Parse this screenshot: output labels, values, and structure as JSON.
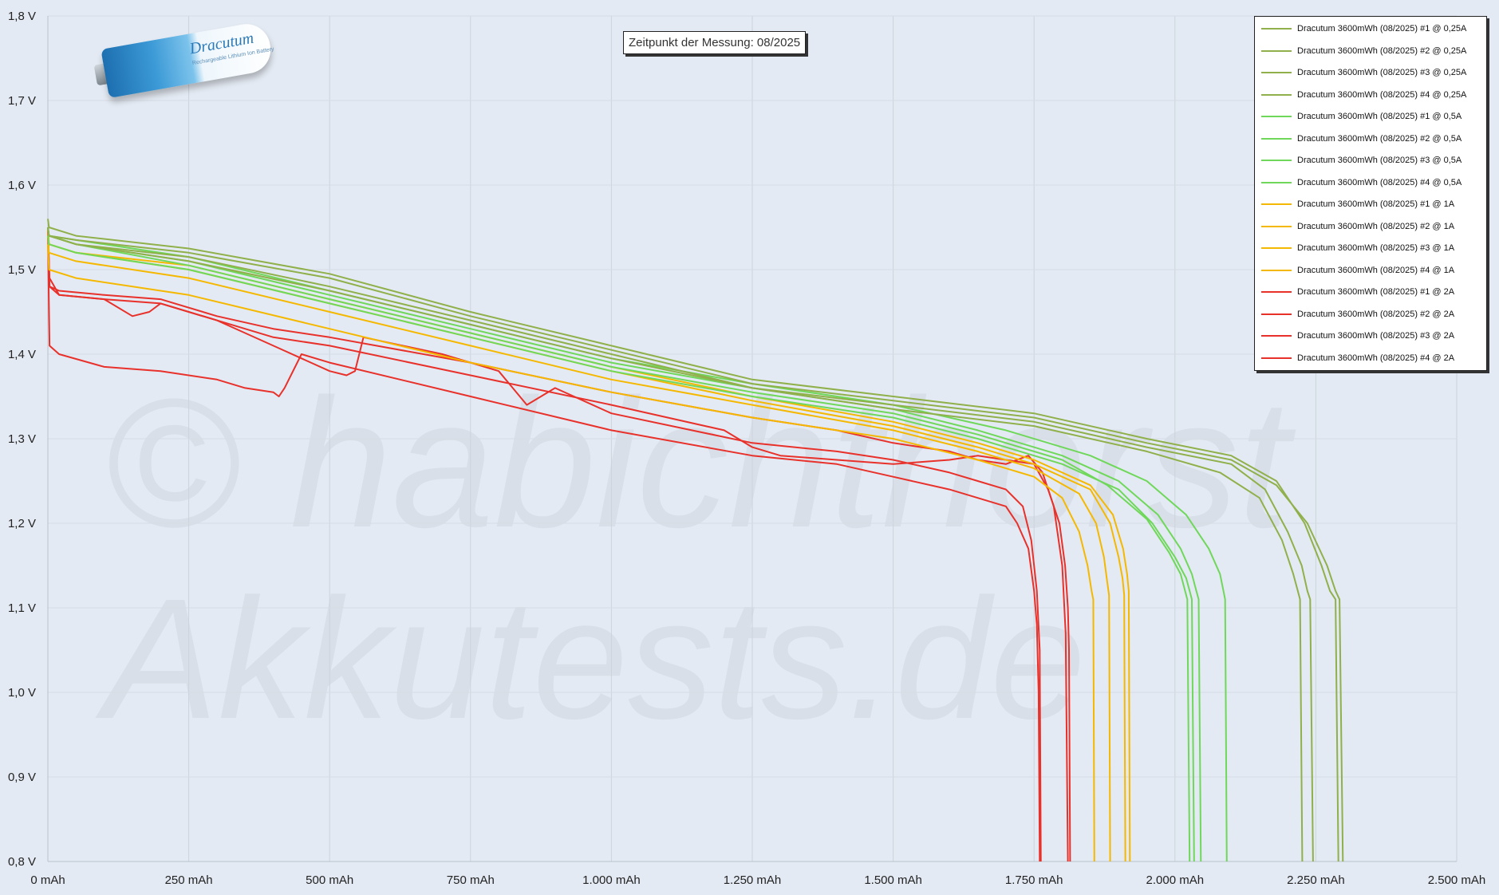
{
  "chart_data": {
    "type": "line",
    "title": "",
    "annotation": "Zeitpunkt der Messung: 08/2025",
    "xlabel": "",
    "ylabel": "",
    "xlim": [
      0,
      2500
    ],
    "ylim": [
      0.8,
      1.8
    ],
    "x_ticks": [
      "0 mAh",
      "250 mAh",
      "500 mAh",
      "750 mAh",
      "1.000 mAh",
      "1.250 mAh",
      "1.500 mAh",
      "1.750 mAh",
      "2.000 mAh",
      "2.250 mAh",
      "2.500 mAh"
    ],
    "y_ticks": [
      "0,8 V",
      "0,9 V",
      "1,0 V",
      "1,1 V",
      "1,2 V",
      "1,3 V",
      "1,4 V",
      "1,5 V",
      "1,6 V",
      "1,7 V",
      "1,8 V"
    ],
    "grid": "vertical",
    "legend_position": "top-right",
    "watermark": "© habichthorst Akkutests.de",
    "series": [
      {
        "name": "Dracutum 3600mWh (08/2025) #1 @ 0,25A",
        "color": "#8fb04a",
        "x": [
          0,
          2,
          50,
          250,
          500,
          750,
          1000,
          1250,
          1500,
          1750,
          1950,
          2100,
          2180,
          2230,
          2260,
          2275,
          2285,
          2290
        ],
        "y": [
          1.56,
          1.55,
          1.54,
          1.525,
          1.495,
          1.45,
          1.41,
          1.37,
          1.35,
          1.33,
          1.3,
          1.28,
          1.25,
          1.2,
          1.15,
          1.12,
          1.11,
          0.8
        ]
      },
      {
        "name": "Dracutum 3600mWh (08/2025) #2 @ 0,25A",
        "color": "#8fb04a",
        "x": [
          0,
          2,
          50,
          250,
          500,
          750,
          1000,
          1250,
          1500,
          1750,
          1950,
          2100,
          2160,
          2200,
          2225,
          2235,
          2240,
          2245
        ],
        "y": [
          1.55,
          1.54,
          1.53,
          1.515,
          1.48,
          1.44,
          1.4,
          1.36,
          1.34,
          1.32,
          1.29,
          1.27,
          1.24,
          1.19,
          1.15,
          1.12,
          1.11,
          0.8
        ]
      },
      {
        "name": "Dracutum 3600mWh (08/2025) #3 @ 0,25A",
        "color": "#8fb04a",
        "x": [
          0,
          2,
          50,
          250,
          500,
          750,
          1000,
          1250,
          1500,
          1750,
          1950,
          2100,
          2180,
          2235,
          2270,
          2285,
          2292,
          2298
        ],
        "y": [
          1.55,
          1.54,
          1.535,
          1.52,
          1.49,
          1.445,
          1.405,
          1.365,
          1.345,
          1.325,
          1.295,
          1.275,
          1.245,
          1.2,
          1.15,
          1.12,
          1.11,
          0.8
        ]
      },
      {
        "name": "Dracutum 3600mWh (08/2025) #4 @ 0,25A",
        "color": "#8fb04a",
        "x": [
          0,
          2,
          50,
          250,
          500,
          750,
          1000,
          1250,
          1500,
          1750,
          1950,
          2080,
          2150,
          2190,
          2210,
          2218,
          2222,
          2226
        ],
        "y": [
          1.55,
          1.54,
          1.53,
          1.51,
          1.475,
          1.435,
          1.395,
          1.36,
          1.335,
          1.315,
          1.285,
          1.26,
          1.23,
          1.18,
          1.14,
          1.12,
          1.11,
          0.8
        ]
      },
      {
        "name": "Dracutum 3600mWh (08/2025) #1 @ 0,5A",
        "color": "#6fd85a",
        "x": [
          0,
          2,
          50,
          250,
          500,
          750,
          1000,
          1250,
          1500,
          1650,
          1800,
          1900,
          1970,
          2010,
          2030,
          2038,
          2042,
          2046
        ],
        "y": [
          1.55,
          1.54,
          1.53,
          1.51,
          1.47,
          1.43,
          1.39,
          1.36,
          1.335,
          1.31,
          1.28,
          1.25,
          1.21,
          1.17,
          1.14,
          1.12,
          1.11,
          0.8
        ]
      },
      {
        "name": "Dracutum 3600mWh (08/2025) #2 @ 0,5A",
        "color": "#6fd85a",
        "x": [
          0,
          2,
          50,
          250,
          500,
          750,
          1000,
          1250,
          1500,
          1650,
          1800,
          1880,
          1950,
          1990,
          2010,
          2018,
          2022,
          2026
        ],
        "y": [
          1.55,
          1.54,
          1.53,
          1.505,
          1.465,
          1.425,
          1.385,
          1.355,
          1.33,
          1.305,
          1.275,
          1.245,
          1.205,
          1.165,
          1.14,
          1.12,
          1.11,
          0.8
        ]
      },
      {
        "name": "Dracutum 3600mWh (08/2025) #3 @ 0,5A",
        "color": "#6fd85a",
        "x": [
          0,
          2,
          50,
          250,
          500,
          750,
          1000,
          1250,
          1500,
          1700,
          1850,
          1950,
          2020,
          2060,
          2080,
          2086,
          2089,
          2092
        ],
        "y": [
          1.55,
          1.54,
          1.535,
          1.515,
          1.475,
          1.435,
          1.395,
          1.365,
          1.34,
          1.31,
          1.28,
          1.25,
          1.21,
          1.17,
          1.14,
          1.12,
          1.11,
          0.8
        ]
      },
      {
        "name": "Dracutum 3600mWh (08/2025) #4 @ 0,5A",
        "color": "#6fd85a",
        "x": [
          0,
          2,
          50,
          250,
          500,
          750,
          1000,
          1250,
          1500,
          1650,
          1800,
          1900,
          1960,
          2000,
          2020,
          2026,
          2030,
          2034
        ],
        "y": [
          1.54,
          1.53,
          1.52,
          1.5,
          1.46,
          1.42,
          1.38,
          1.35,
          1.325,
          1.3,
          1.27,
          1.24,
          1.2,
          1.16,
          1.135,
          1.12,
          1.11,
          0.8
        ]
      },
      {
        "name": "Dracutum 3600mWh (08/2025) #1 @ 1A",
        "color": "#f5b800",
        "x": [
          0,
          2,
          50,
          250,
          500,
          750,
          1000,
          1250,
          1500,
          1650,
          1750,
          1800,
          1830,
          1845,
          1852,
          1855,
          1857
        ],
        "y": [
          1.53,
          1.5,
          1.49,
          1.47,
          1.43,
          1.39,
          1.355,
          1.325,
          1.3,
          1.275,
          1.255,
          1.23,
          1.19,
          1.15,
          1.12,
          1.11,
          0.8
        ]
      },
      {
        "name": "Dracutum 3600mWh (08/2025) #2 @ 1A",
        "color": "#f5b800",
        "x": [
          0,
          2,
          50,
          250,
          500,
          750,
          1000,
          1250,
          1500,
          1650,
          1750,
          1830,
          1860,
          1874,
          1880,
          1883,
          1885
        ],
        "y": [
          1.54,
          1.52,
          1.51,
          1.49,
          1.45,
          1.41,
          1.37,
          1.34,
          1.31,
          1.285,
          1.265,
          1.235,
          1.2,
          1.16,
          1.13,
          1.115,
          0.8
        ]
      },
      {
        "name": "Dracutum 3600mWh (08/2025) #3 @ 1A",
        "color": "#f5b800",
        "x": [
          0,
          2,
          50,
          250,
          500,
          750,
          1000,
          1250,
          1500,
          1650,
          1750,
          1850,
          1885,
          1900,
          1907,
          1910,
          1912
        ],
        "y": [
          1.55,
          1.53,
          1.52,
          1.5,
          1.46,
          1.42,
          1.38,
          1.345,
          1.315,
          1.29,
          1.27,
          1.24,
          1.2,
          1.16,
          1.135,
          1.115,
          0.8
        ]
      },
      {
        "name": "Dracutum 3600mWh (08/2025) #4 @ 1A",
        "color": "#f5b800",
        "x": [
          0,
          2,
          50,
          250,
          500,
          750,
          1000,
          1250,
          1500,
          1650,
          1750,
          1850,
          1890,
          1908,
          1915,
          1918,
          1920
        ],
        "y": [
          1.55,
          1.53,
          1.52,
          1.505,
          1.465,
          1.425,
          1.385,
          1.35,
          1.32,
          1.295,
          1.275,
          1.245,
          1.21,
          1.17,
          1.14,
          1.12,
          0.8
        ]
      },
      {
        "name": "Dracutum 3600mWh (08/2025) #1 @ 2A",
        "color": "#e8312b",
        "x": [
          0,
          3,
          20,
          100,
          200,
          300,
          350,
          400,
          410,
          420,
          450,
          500,
          750,
          1000,
          1250,
          1400,
          1500,
          1600,
          1650,
          1700,
          1720,
          1740,
          1750,
          1755,
          1758,
          1760
        ],
        "y": [
          1.54,
          1.41,
          1.4,
          1.385,
          1.38,
          1.37,
          1.36,
          1.355,
          1.35,
          1.36,
          1.4,
          1.39,
          1.35,
          1.31,
          1.28,
          1.27,
          1.255,
          1.24,
          1.23,
          1.22,
          1.2,
          1.17,
          1.12,
          1.08,
          1.0,
          0.8
        ]
      },
      {
        "name": "Dracutum 3600mWh (08/2025) #2 @ 2A",
        "color": "#e8312b",
        "x": [
          0,
          3,
          20,
          100,
          200,
          300,
          400,
          500,
          530,
          545,
          560,
          700,
          800,
          850,
          900,
          1000,
          1250,
          1400,
          1500,
          1600,
          1650,
          1700,
          1730,
          1745,
          1755,
          1760,
          1762
        ],
        "y": [
          1.55,
          1.49,
          1.47,
          1.465,
          1.46,
          1.44,
          1.41,
          1.38,
          1.375,
          1.38,
          1.42,
          1.4,
          1.38,
          1.34,
          1.36,
          1.33,
          1.295,
          1.285,
          1.275,
          1.26,
          1.25,
          1.24,
          1.22,
          1.18,
          1.12,
          1.05,
          0.8
        ]
      },
      {
        "name": "Dracutum 3600mWh (08/2025) #3 @ 2A",
        "color": "#e8312b",
        "x": [
          0,
          3,
          20,
          100,
          150,
          180,
          200,
          300,
          400,
          500,
          750,
          1000,
          1200,
          1250,
          1300,
          1400,
          1500,
          1600,
          1650,
          1700,
          1750,
          1775,
          1795,
          1805,
          1810,
          1812,
          1814
        ],
        "y": [
          1.55,
          1.48,
          1.47,
          1.465,
          1.445,
          1.45,
          1.46,
          1.44,
          1.42,
          1.41,
          1.375,
          1.34,
          1.31,
          1.29,
          1.28,
          1.275,
          1.27,
          1.275,
          1.28,
          1.275,
          1.27,
          1.24,
          1.2,
          1.15,
          1.1,
          1.05,
          0.8
        ]
      },
      {
        "name": "Dracutum 3600mWh (08/2025) #4 @ 2A",
        "color": "#e8312b",
        "x": [
          0,
          3,
          20,
          100,
          200,
          300,
          400,
          500,
          750,
          1000,
          1250,
          1400,
          1500,
          1600,
          1650,
          1700,
          1740,
          1765,
          1785,
          1800,
          1806,
          1810
        ],
        "y": [
          1.55,
          1.48,
          1.475,
          1.47,
          1.465,
          1.445,
          1.43,
          1.42,
          1.39,
          1.355,
          1.325,
          1.31,
          1.295,
          1.285,
          1.275,
          1.27,
          1.28,
          1.26,
          1.22,
          1.15,
          1.07,
          0.8
        ]
      }
    ]
  }
}
